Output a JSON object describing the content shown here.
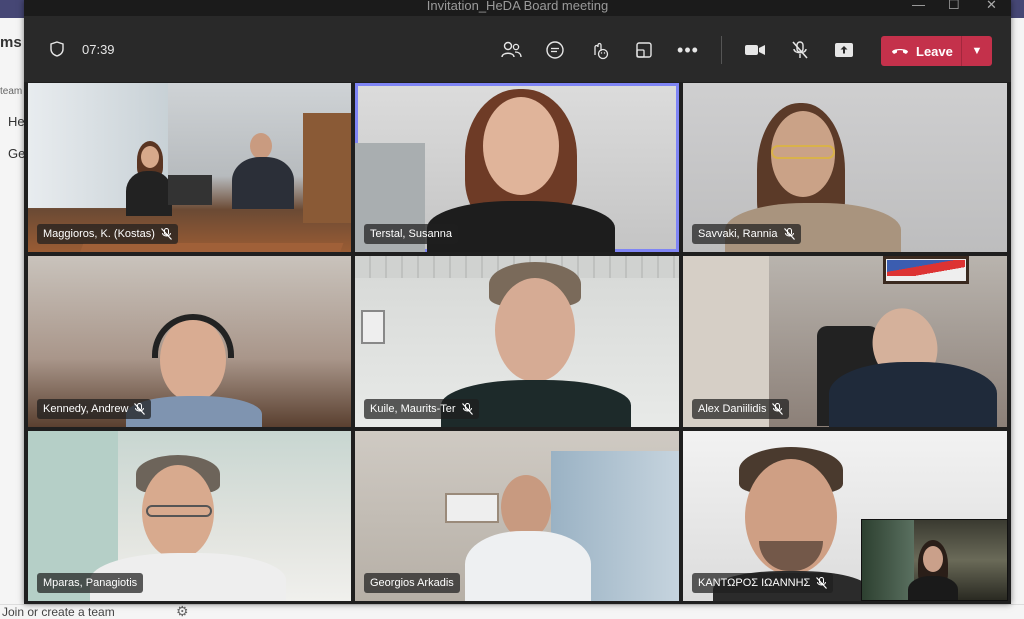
{
  "background_app": {
    "sidebar_fragments": [
      "ms",
      "team",
      "He",
      "Ge"
    ],
    "bottom_link": "Join or create a team"
  },
  "window": {
    "title": "Invitation_HeDA Board meeting",
    "controls": [
      "minimize",
      "maximize",
      "close"
    ]
  },
  "toolbar": {
    "time": "07:39",
    "icons": [
      "participants-icon",
      "chat-icon",
      "reactions-icon",
      "rooms-icon",
      "more-icon",
      "camera-icon",
      "mic-off-icon",
      "share-icon"
    ],
    "leave_label": "Leave"
  },
  "participants": [
    {
      "name": "Maggioros, K. (Kostas)",
      "muted": true,
      "active": false
    },
    {
      "name": "Terstal, Susanna",
      "muted": false,
      "active": true
    },
    {
      "name": "Savvaki, Rannia",
      "muted": true,
      "active": false
    },
    {
      "name": "Kennedy, Andrew",
      "muted": true,
      "active": false
    },
    {
      "name": "Kuile, Maurits-Ter",
      "muted": true,
      "active": false
    },
    {
      "name": "Alex Daniilidis",
      "muted": true,
      "active": false
    },
    {
      "name": "Mparas, Panagiotis",
      "muted": false,
      "active": false
    },
    {
      "name": "Georgios Arkadis",
      "muted": false,
      "active": false
    },
    {
      "name": "ΚΑΝΤΩΡΟΣ ΙΩΑΝΝΗΣ",
      "muted": true,
      "active": false
    }
  ],
  "colors": {
    "accent": "#7f85f5",
    "leave": "#c4314b",
    "toolbar": "#292929"
  }
}
